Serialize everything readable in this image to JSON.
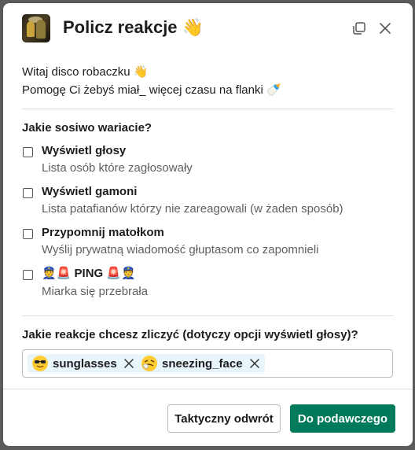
{
  "modal": {
    "title": "Policz reakcje",
    "title_emoji": "👋",
    "intro_line1": "Witaj disco robaczku",
    "intro_line1_emoji": "👋",
    "intro_line2": "Pomogę Ci żebyś miał_ więcej czasu na flanki",
    "intro_line2_emoji": "🍼",
    "options_label": "Jakie sosiwo wariacie?",
    "options": [
      {
        "label": "Wyświetl głosy",
        "description": "Lista osób które zagłosowały",
        "checked": false
      },
      {
        "label": "Wyświetl gamoni",
        "description": "Lista patafianów którzy nie zareagowali (w żaden sposób)",
        "checked": false
      },
      {
        "label": "Przypomnij matołkom",
        "description": "Wyślij prywatną wiadomość głuptasom co zapomnieli",
        "checked": false
      },
      {
        "label": "PING",
        "label_prefix_emoji": "👮🚨",
        "label_suffix_emoji": "🚨👮",
        "description": "Miarka się przebrała",
        "checked": false
      }
    ],
    "reactions_label": "Jakie reakcje chcesz zliczyć (dotyczy opcji wyświetl głosy)?",
    "reactions": [
      {
        "name": "sunglasses",
        "icon": "sunglasses-face-icon"
      },
      {
        "name": "sneezing_face",
        "icon": "sneezing-face-icon"
      }
    ],
    "cancel_label": "Taktyczny odwrót",
    "submit_label": "Do podawczego"
  },
  "colors": {
    "primary": "#007a5a",
    "chip_bg": "#e8f5fa",
    "text": "#1d1c1d",
    "muted": "#616061"
  }
}
